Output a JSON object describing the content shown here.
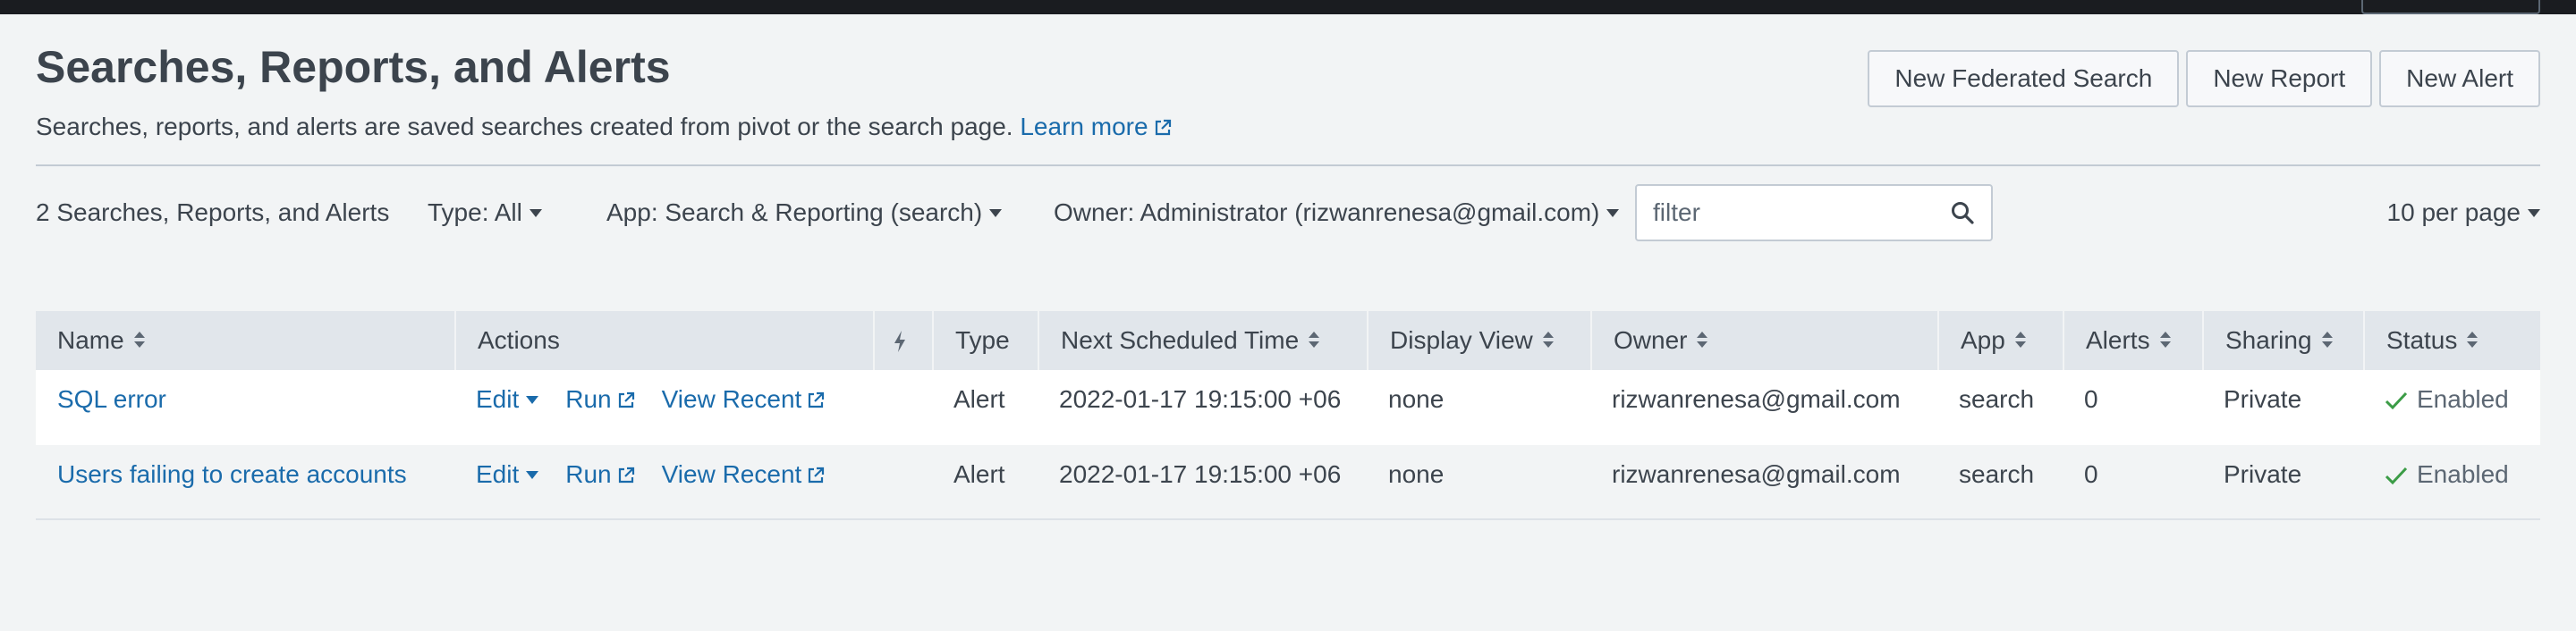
{
  "header": {
    "title": "Searches, Reports, and Alerts",
    "description": "Searches, reports, and alerts are saved searches created from pivot or the search page.",
    "learn_more": "Learn more",
    "buttons": {
      "new_federated_search": "New Federated Search",
      "new_report": "New Report",
      "new_alert": "New Alert"
    }
  },
  "toolbar": {
    "count": "2 Searches, Reports, and Alerts",
    "type_filter": "Type: All",
    "app_filter": "App: Search & Reporting (search)",
    "owner_filter": "Owner: Administrator (rizwanrenesa@gmail.com)",
    "filter_placeholder": "filter",
    "per_page": "10 per page"
  },
  "table": {
    "columns": {
      "name": "Name",
      "actions": "Actions",
      "type": "Type",
      "next_scheduled_time": "Next Scheduled Time",
      "display_view": "Display View",
      "owner": "Owner",
      "app": "App",
      "alerts": "Alerts",
      "sharing": "Sharing",
      "status": "Status"
    },
    "action_labels": {
      "edit": "Edit",
      "run": "Run",
      "view_recent": "View Recent"
    },
    "rows": [
      {
        "name": "SQL error",
        "type": "Alert",
        "next_scheduled_time": "2022-01-17 19:15:00 +06",
        "display_view": "none",
        "owner": "rizwanrenesa@gmail.com",
        "app": "search",
        "alerts": "0",
        "sharing": "Private",
        "status": "Enabled"
      },
      {
        "name": "Users failing to create accounts",
        "type": "Alert",
        "next_scheduled_time": "2022-01-17 19:15:00 +06",
        "display_view": "none",
        "owner": "rizwanrenesa@gmail.com",
        "app": "search",
        "alerts": "0",
        "sharing": "Private",
        "status": "Enabled"
      }
    ]
  },
  "colors": {
    "link": "#1a6bab",
    "text": "#3c444d",
    "enabled_check": "#3b9c46",
    "header_bg": "#e1e6eb",
    "page_bg": "#f2f4f5"
  },
  "icons": {
    "external_link": "external-link-icon",
    "sort": "sort-icon",
    "search": "search-icon",
    "lightning": "lightning-icon",
    "check": "check-icon"
  }
}
